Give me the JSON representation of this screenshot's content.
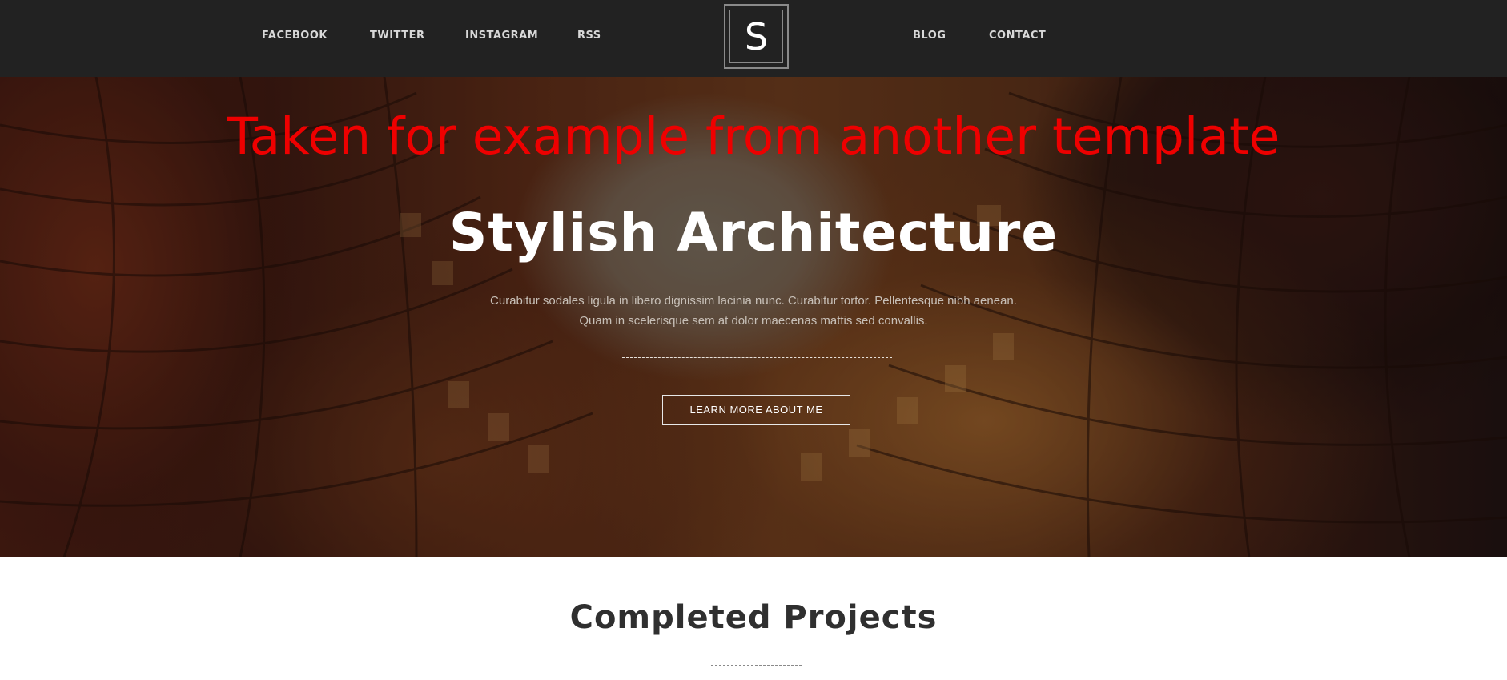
{
  "header": {
    "nav_left": [
      {
        "label": "FACEBOOK"
      },
      {
        "label": "TWITTER"
      },
      {
        "label": "INSTAGRAM"
      },
      {
        "label": "RSS"
      }
    ],
    "logo_letter": "S",
    "nav_right": [
      {
        "label": "BLOG"
      },
      {
        "label": "CONTACT"
      }
    ]
  },
  "hero": {
    "warning": "Taken for example from another template",
    "title": "Stylish Architecture",
    "description_line1": "Curabitur sodales ligula in libero dignissim lacinia nunc. Curabitur tortor. Pellentesque nibh aenean.",
    "description_line2": "Quam in scelerisque sem at dolor maecenas mattis sed convallis.",
    "button_label": "LEARN MORE ABOUT ME"
  },
  "projects": {
    "title": "Completed Projects"
  },
  "colors": {
    "header_bg": "#222222",
    "warning_text": "#ee0000",
    "hero_title": "#ffffff",
    "section_title": "#2f2f2f"
  }
}
